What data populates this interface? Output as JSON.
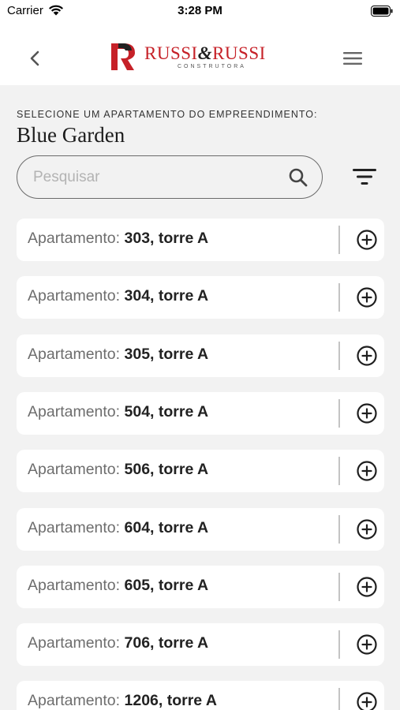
{
  "status_bar": {
    "carrier": "Carrier",
    "time": "3:28 PM",
    "wifi_icon": "wifi-icon",
    "battery_icon": "battery-icon"
  },
  "header": {
    "back_icon": "chevron-left-icon",
    "menu_icon": "hamburger-menu-icon",
    "logo": {
      "name_left": "RUSSI",
      "ampersand": "&",
      "name_right": "RUSSI",
      "tagline": "CONSTRUTORA",
      "brand_color": "#c62128"
    }
  },
  "main": {
    "subtitle": "SELECIONE UM APARTAMENTO DO EMPREENDIMENTO:",
    "title": "Blue Garden",
    "search": {
      "placeholder": "Pesquisar",
      "value": "",
      "icon": "search-icon"
    },
    "filter_icon": "filter-icon",
    "item_label": "Apartamento:",
    "items": [
      {
        "value": "303, torre A"
      },
      {
        "value": "304, torre A"
      },
      {
        "value": "305, torre A"
      },
      {
        "value": "504, torre A"
      },
      {
        "value": "506, torre A"
      },
      {
        "value": "604, torre A"
      },
      {
        "value": "605, torre A"
      },
      {
        "value": "706, torre A"
      },
      {
        "value": "1206, torre A"
      }
    ],
    "add_icon": "plus-circle-icon"
  },
  "colors": {
    "background": "#f2f2f2",
    "card": "#ffffff",
    "accent": "#c62128",
    "text_dark": "#222222",
    "text_muted": "#6d6d6d"
  }
}
